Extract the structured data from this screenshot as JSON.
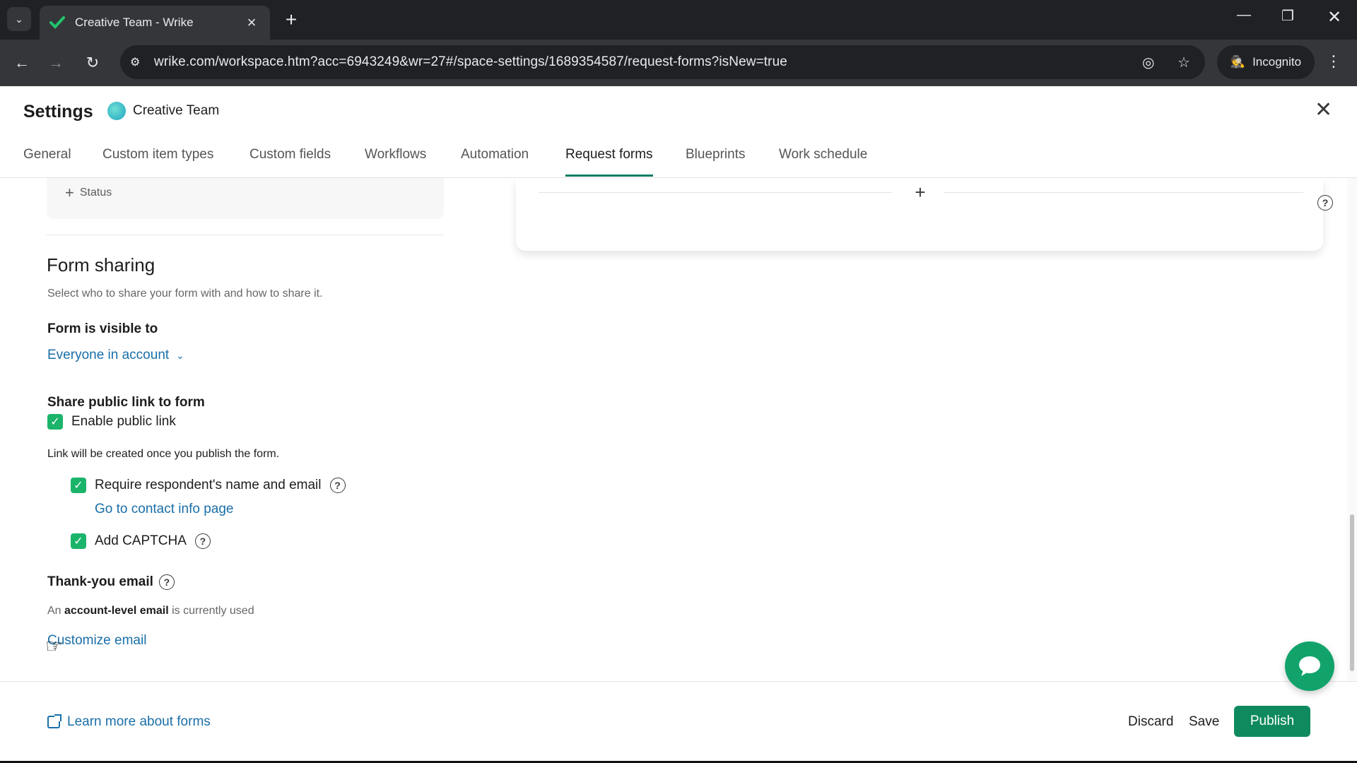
{
  "browser": {
    "tab_title": "Creative Team - Wrike",
    "url": "wrike.com/workspace.htm?acc=6943249&wr=27#/space-settings/1689354587/request-forms?isNew=true",
    "incognito_label": "Incognito"
  },
  "settings": {
    "title": "Settings",
    "space_name": "Creative Team",
    "tabs": [
      {
        "label": "General"
      },
      {
        "label": "Custom item types"
      },
      {
        "label": "Custom fields"
      },
      {
        "label": "Workflows"
      },
      {
        "label": "Automation"
      },
      {
        "label": "Request forms"
      },
      {
        "label": "Blueprints"
      },
      {
        "label": "Work schedule"
      }
    ],
    "active_tab": "Request forms"
  },
  "form": {
    "add_status_label": "Status",
    "sharing_title": "Form sharing",
    "sharing_desc": "Select who to share your form with and how to share it.",
    "visible_label": "Form is visible to",
    "visibility_value": "Everyone in account",
    "share_label": "Share public link to form",
    "enable_public_link": "Enable public link",
    "link_note": "Link will be created once you publish the form.",
    "require_name_email": "Require respondent's name and email",
    "contact_link": "Go to contact info page",
    "captcha": "Add CAPTCHA",
    "thankyou_label": "Thank-you email",
    "thankyou_prefix": "An",
    "thankyou_bold": "account-level email",
    "thankyou_suffix": "is currently used",
    "customize_link": "Customize email"
  },
  "footer": {
    "learn_link": "Learn more about forms",
    "discard": "Discard",
    "save": "Save",
    "publish": "Publish"
  },
  "colors": {
    "accent_green": "#0f8a5f",
    "link_blue": "#1a6fa8",
    "checkbox_green": "#1bb46a"
  }
}
